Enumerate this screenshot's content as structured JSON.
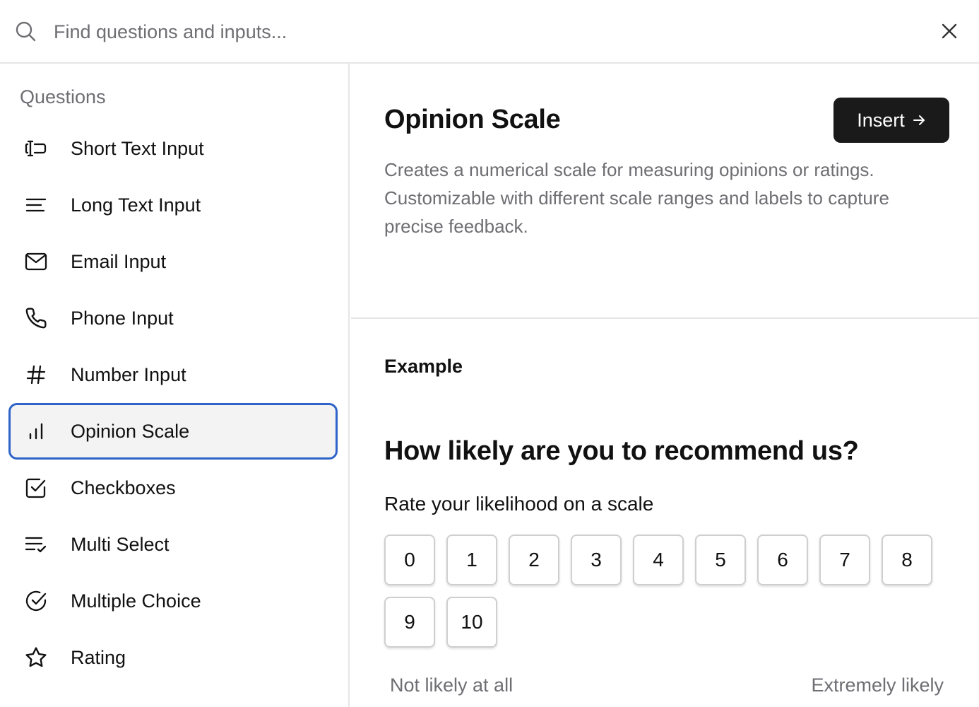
{
  "search": {
    "placeholder": "Find questions and inputs..."
  },
  "sidebar": {
    "section_title": "Questions",
    "items": [
      {
        "label": "Short Text Input",
        "icon": "text-cursor-input-icon"
      },
      {
        "label": "Long Text Input",
        "icon": "align-left-icon"
      },
      {
        "label": "Email Input",
        "icon": "mail-icon"
      },
      {
        "label": "Phone Input",
        "icon": "phone-icon"
      },
      {
        "label": "Number Input",
        "icon": "hash-icon"
      },
      {
        "label": "Opinion Scale",
        "icon": "bar-chart-icon",
        "selected": true
      },
      {
        "label": "Checkboxes",
        "icon": "check-square-icon"
      },
      {
        "label": "Multi Select",
        "icon": "list-checks-icon"
      },
      {
        "label": "Multiple Choice",
        "icon": "circle-check-icon"
      },
      {
        "label": "Rating",
        "icon": "star-icon"
      }
    ]
  },
  "detail": {
    "title": "Opinion Scale",
    "insert_label": "Insert",
    "description": "Creates a numerical scale for measuring opinions or ratings. Customizable with different scale ranges and labels to capture precise feedback.",
    "example_label": "Example",
    "example": {
      "question": "How likely are you to recommend us?",
      "subtext": "Rate your likelihood on a scale",
      "scale": [
        "0",
        "1",
        "2",
        "3",
        "4",
        "5",
        "6",
        "7",
        "8",
        "9",
        "10"
      ],
      "low_label": "Not likely at all",
      "high_label": "Extremely likely"
    }
  },
  "colors": {
    "selected_border": "#2e63c9",
    "insert_bg": "#1a1a1a",
    "muted_text": "#6e6e73"
  }
}
